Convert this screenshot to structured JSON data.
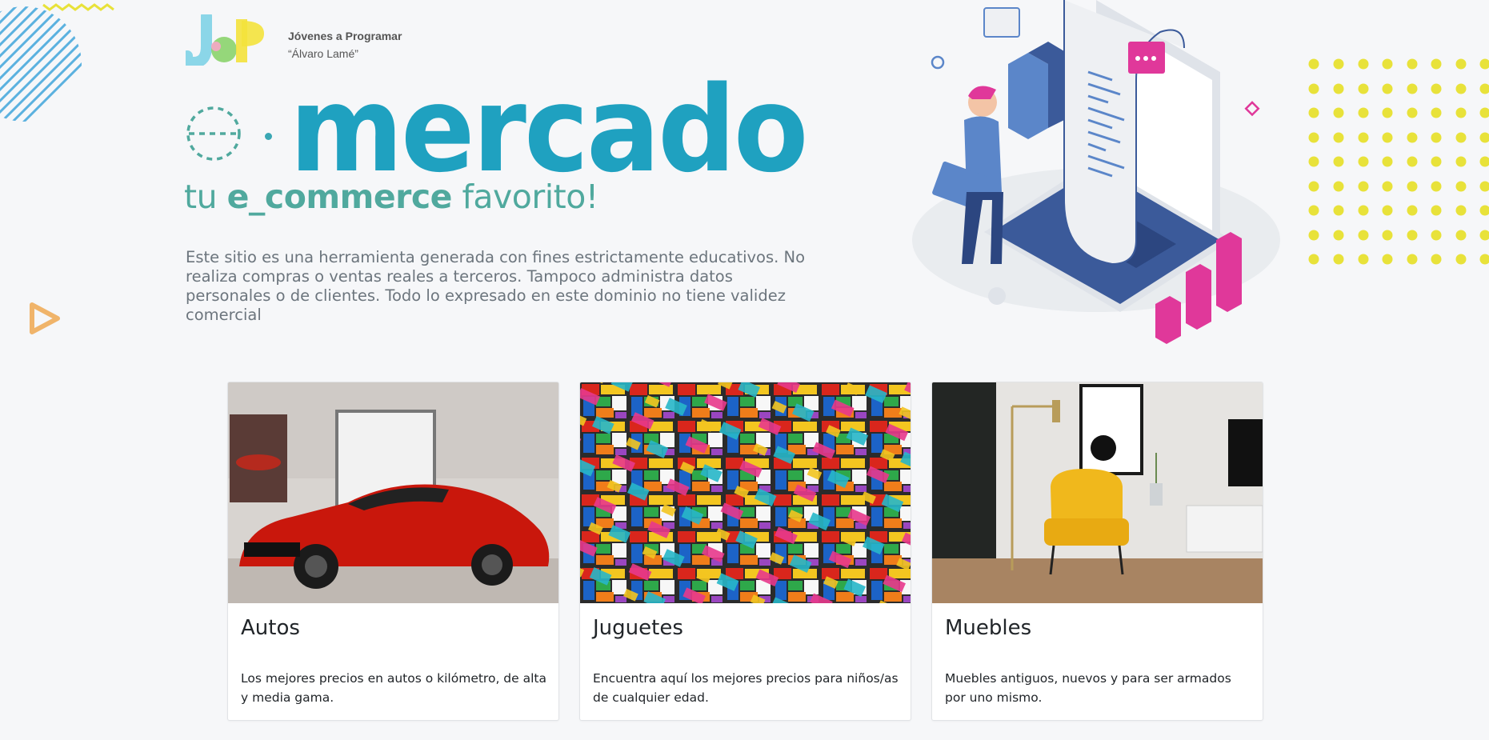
{
  "brand": {
    "logo_letters": "JaP",
    "org_line1": "Jóvenes a Programar",
    "org_line2": "“Álvaro Lamé”"
  },
  "hero": {
    "title_prefix": "e",
    "title": "mercado",
    "subtitle_before": "tu ",
    "subtitle_bold": "e_commerce",
    "subtitle_after": " favorito!",
    "description": "Este sitio  es una herramienta generada con fines estrictamente educativos. No realiza compras o ventas reales a terceros. Tampoco administra datos personales o de clientes. Todo lo expresado en este dominio no tiene validez comercial"
  },
  "colors": {
    "title": "#1fa1c0",
    "subtitle": "#50a99e",
    "accent_yellow": "#e8e23a",
    "accent_pink": "#e0389a",
    "accent_blue": "#3b5a9a"
  },
  "categories": [
    {
      "name": "Autos",
      "description": "Los mejores precios en autos o kilómetro, de alta y media gama.",
      "image": "red-sports-car-photo"
    },
    {
      "name": "Juguetes",
      "description": "Encuentra aquí los mejores precios para niños/as de cualquier edad.",
      "image": "lego-bricks-photo"
    },
    {
      "name": "Muebles",
      "description": "Muebles antiguos, nuevos y para ser armados por uno mismo.",
      "image": "living-room-armchair-photo"
    }
  ]
}
